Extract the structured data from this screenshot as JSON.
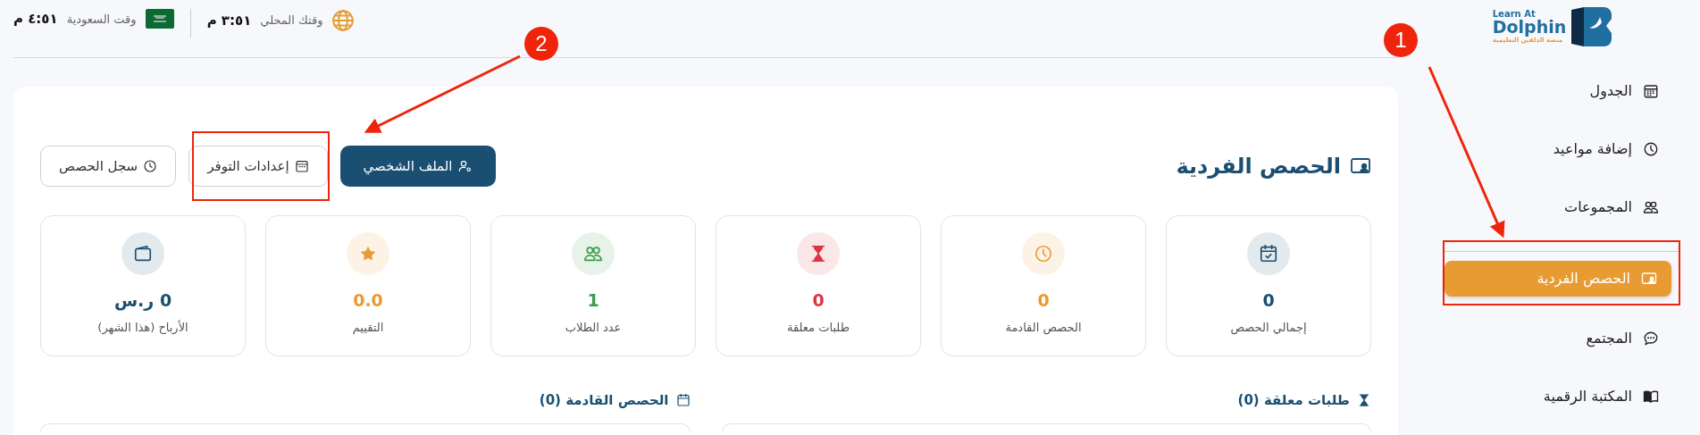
{
  "top_bar": {
    "saudi_time": {
      "value": "٤:٥١ م",
      "label": "وقت السعودية"
    },
    "local_time": {
      "value": "٣:٥١ م",
      "label": "وقتك المحلي"
    }
  },
  "sidebar": {
    "logo": {
      "line1": "Learn At",
      "line2": "Dolphin",
      "tagline": "منصة الدلفين التعليمية"
    },
    "items": [
      {
        "label": "الجدول",
        "selected": false,
        "highlighted": false
      },
      {
        "label": "إضافة مواعيد",
        "selected": false,
        "highlighted": false
      },
      {
        "label": "المجموعات",
        "selected": false,
        "highlighted": false
      },
      {
        "label": "الحصص الفردية",
        "selected": true,
        "highlighted": true
      },
      {
        "label": "المجتمع",
        "selected": false,
        "highlighted": false
      },
      {
        "label": "المكتبة الرقمية",
        "selected": false,
        "highlighted": false
      }
    ]
  },
  "page": {
    "title": "الحصص الفردية",
    "buttons": [
      {
        "label": "الملف الشخصي",
        "kind": "primary",
        "highlighted": false
      },
      {
        "label": "إعدادات التوفر",
        "kind": "outline",
        "highlighted": true
      },
      {
        "label": "سجل الحصص",
        "kind": "outline",
        "highlighted": false
      }
    ],
    "stats": [
      {
        "value": "0",
        "label": "إجمالي الحصص",
        "color": "#1a4f72"
      },
      {
        "value": "0",
        "label": "الحصص القادمة",
        "color": "#e89b32"
      },
      {
        "value": "0",
        "label": "طلبات معلقة",
        "color": "#dc3545"
      },
      {
        "value": "1",
        "label": "عدد الطلاب",
        "color": "#3a9d4a"
      },
      {
        "value": "0.0",
        "label": "التقييم",
        "color": "#e89b32"
      },
      {
        "value": "0 ر.س",
        "label": "الأرباح (هذا الشهر)",
        "color": "#1a4f72"
      }
    ],
    "sections": [
      {
        "title": "طلبات معلقة (0)"
      },
      {
        "title": "الحصص القادمة (0)"
      }
    ]
  },
  "annotations": [
    {
      "number": "1"
    },
    {
      "number": "2"
    }
  ]
}
